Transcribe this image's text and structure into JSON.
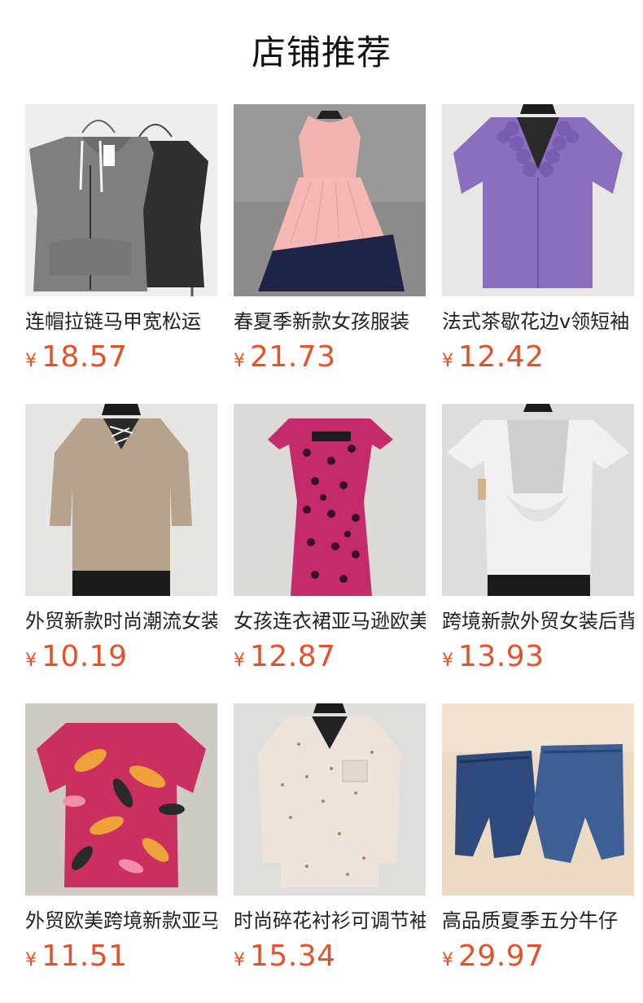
{
  "header": {
    "title": "店铺推荐"
  },
  "products": [
    {
      "name": "连帽拉链马甲宽松运",
      "currency": "¥",
      "price": "18.57",
      "icon": "hooded-vest-icon"
    },
    {
      "name": "春夏季新款女孩服装",
      "currency": "¥",
      "price": "21.73",
      "icon": "pink-navy-dress-icon"
    },
    {
      "name": "法式茶歇花边v领短袖",
      "currency": "¥",
      "price": "12.42",
      "icon": "purple-ruffle-top-icon"
    },
    {
      "name": "外贸新款时尚潮流女装",
      "currency": "¥",
      "price": "10.19",
      "icon": "lace-up-sweater-icon"
    },
    {
      "name": "女孩连衣裙亚马逊欧美",
      "currency": "¥",
      "price": "12.87",
      "icon": "leopard-dress-icon"
    },
    {
      "name": "跨境新款外贸女装后背",
      "currency": "¥",
      "price": "13.93",
      "icon": "lace-back-top-icon"
    },
    {
      "name": "外贸欧美跨境新款亚马",
      "currency": "¥",
      "price": "11.51",
      "icon": "floral-blouse-icon"
    },
    {
      "name": "时尚碎花衬衫可调节袖",
      "currency": "¥",
      "price": "15.34",
      "icon": "floral-shirt-icon"
    },
    {
      "name": "高品质夏季五分牛仔",
      "currency": "¥",
      "price": "29.97",
      "icon": "denim-shorts-icon"
    }
  ],
  "colors": {
    "price": "#e4512a",
    "text": "#222222",
    "background": "#ffffff"
  }
}
